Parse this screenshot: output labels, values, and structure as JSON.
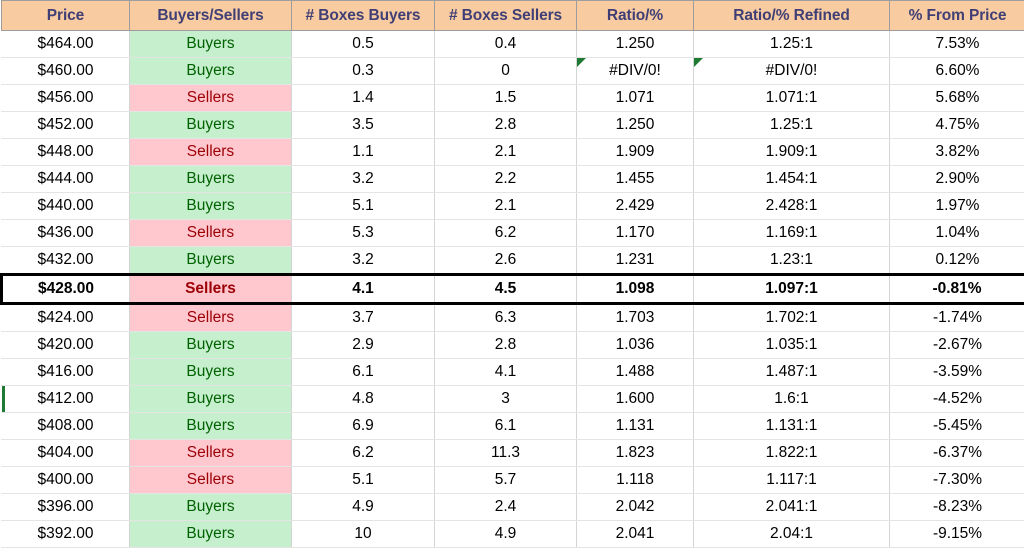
{
  "spreadsheet": {
    "columns": [
      {
        "key": "price",
        "label": "Price"
      },
      {
        "key": "buyers_sellers",
        "label": "Buyers/Sellers"
      },
      {
        "key": "boxes_buyers",
        "label": "# Boxes Buyers"
      },
      {
        "key": "boxes_sellers",
        "label": "# Boxes Sellers"
      },
      {
        "key": "ratio_pct",
        "label": "Ratio/%"
      },
      {
        "key": "ratio_refined",
        "label": "Ratio/% Refined"
      },
      {
        "key": "pct_from_price",
        "label": "% From Price"
      }
    ],
    "colors": {
      "header_fill": "#F8CBA0",
      "header_text": "#3F3F76",
      "good_fill": "#C6EFCE",
      "good_text": "#006100",
      "bad_fill": "#FFC7CE",
      "bad_text": "#9C0006",
      "error_indicator": "#1E7A32",
      "highlight_border": "#000000"
    },
    "rows": [
      {
        "price": "$464.00",
        "buyers_sellers": "Buyers",
        "side": "good",
        "boxes_buyers": "0.5",
        "boxes_sellers": "0.4",
        "ratio_pct": "1.250",
        "ratio_refined": "1.25:1",
        "pct_from_price": "7.53%",
        "highlight": false,
        "error_flags": []
      },
      {
        "price": "$460.00",
        "buyers_sellers": "Buyers",
        "side": "good",
        "boxes_buyers": "0.3",
        "boxes_sellers": "0",
        "ratio_pct": "#DIV/0!",
        "ratio_refined": "#DIV/0!",
        "pct_from_price": "6.60%",
        "highlight": false,
        "error_flags": [
          "ratio_pct",
          "ratio_refined"
        ]
      },
      {
        "price": "$456.00",
        "buyers_sellers": "Sellers",
        "side": "bad",
        "boxes_buyers": "1.4",
        "boxes_sellers": "1.5",
        "ratio_pct": "1.071",
        "ratio_refined": "1.071:1",
        "pct_from_price": "5.68%",
        "highlight": false,
        "error_flags": []
      },
      {
        "price": "$452.00",
        "buyers_sellers": "Buyers",
        "side": "good",
        "boxes_buyers": "3.5",
        "boxes_sellers": "2.8",
        "ratio_pct": "1.250",
        "ratio_refined": "1.25:1",
        "pct_from_price": "4.75%",
        "highlight": false,
        "error_flags": []
      },
      {
        "price": "$448.00",
        "buyers_sellers": "Sellers",
        "side": "bad",
        "boxes_buyers": "1.1",
        "boxes_sellers": "2.1",
        "ratio_pct": "1.909",
        "ratio_refined": "1.909:1",
        "pct_from_price": "3.82%",
        "highlight": false,
        "error_flags": []
      },
      {
        "price": "$444.00",
        "buyers_sellers": "Buyers",
        "side": "good",
        "boxes_buyers": "3.2",
        "boxes_sellers": "2.2",
        "ratio_pct": "1.455",
        "ratio_refined": "1.454:1",
        "pct_from_price": "2.90%",
        "highlight": false,
        "error_flags": []
      },
      {
        "price": "$440.00",
        "buyers_sellers": "Buyers",
        "side": "good",
        "boxes_buyers": "5.1",
        "boxes_sellers": "2.1",
        "ratio_pct": "2.429",
        "ratio_refined": "2.428:1",
        "pct_from_price": "1.97%",
        "highlight": false,
        "error_flags": []
      },
      {
        "price": "$436.00",
        "buyers_sellers": "Sellers",
        "side": "bad",
        "boxes_buyers": "5.3",
        "boxes_sellers": "6.2",
        "ratio_pct": "1.170",
        "ratio_refined": "1.169:1",
        "pct_from_price": "1.04%",
        "highlight": false,
        "error_flags": []
      },
      {
        "price": "$432.00",
        "buyers_sellers": "Buyers",
        "side": "good",
        "boxes_buyers": "3.2",
        "boxes_sellers": "2.6",
        "ratio_pct": "1.231",
        "ratio_refined": "1.23:1",
        "pct_from_price": "0.12%",
        "highlight": false,
        "error_flags": []
      },
      {
        "price": "$428.00",
        "buyers_sellers": "Sellers",
        "side": "bad",
        "boxes_buyers": "4.1",
        "boxes_sellers": "4.5",
        "ratio_pct": "1.098",
        "ratio_refined": "1.097:1",
        "pct_from_price": "-0.81%",
        "highlight": true,
        "error_flags": []
      },
      {
        "price": "$424.00",
        "buyers_sellers": "Sellers",
        "side": "bad",
        "boxes_buyers": "3.7",
        "boxes_sellers": "6.3",
        "ratio_pct": "1.703",
        "ratio_refined": "1.702:1",
        "pct_from_price": "-1.74%",
        "highlight": false,
        "error_flags": []
      },
      {
        "price": "$420.00",
        "buyers_sellers": "Buyers",
        "side": "good",
        "boxes_buyers": "2.9",
        "boxes_sellers": "2.8",
        "ratio_pct": "1.036",
        "ratio_refined": "1.035:1",
        "pct_from_price": "-2.67%",
        "highlight": false,
        "error_flags": []
      },
      {
        "price": "$416.00",
        "buyers_sellers": "Buyers",
        "side": "good",
        "boxes_buyers": "6.1",
        "boxes_sellers": "4.1",
        "ratio_pct": "1.488",
        "ratio_refined": "1.487:1",
        "pct_from_price": "-3.59%",
        "highlight": false,
        "error_flags": []
      },
      {
        "price": "$412.00",
        "buyers_sellers": "Buyers",
        "side": "good",
        "boxes_buyers": "4.8",
        "boxes_sellers": "3",
        "ratio_pct": "1.600",
        "ratio_refined": "1.6:1",
        "pct_from_price": "-4.52%",
        "highlight": false,
        "error_flags": [],
        "edge_sliver": true
      },
      {
        "price": "$408.00",
        "buyers_sellers": "Buyers",
        "side": "good",
        "boxes_buyers": "6.9",
        "boxes_sellers": "6.1",
        "ratio_pct": "1.131",
        "ratio_refined": "1.131:1",
        "pct_from_price": "-5.45%",
        "highlight": false,
        "error_flags": []
      },
      {
        "price": "$404.00",
        "buyers_sellers": "Sellers",
        "side": "bad",
        "boxes_buyers": "6.2",
        "boxes_sellers": "11.3",
        "ratio_pct": "1.823",
        "ratio_refined": "1.822:1",
        "pct_from_price": "-6.37%",
        "highlight": false,
        "error_flags": []
      },
      {
        "price": "$400.00",
        "buyers_sellers": "Sellers",
        "side": "bad",
        "boxes_buyers": "5.1",
        "boxes_sellers": "5.7",
        "ratio_pct": "1.118",
        "ratio_refined": "1.117:1",
        "pct_from_price": "-7.30%",
        "highlight": false,
        "error_flags": []
      },
      {
        "price": "$396.00",
        "buyers_sellers": "Buyers",
        "side": "good",
        "boxes_buyers": "4.9",
        "boxes_sellers": "2.4",
        "ratio_pct": "2.042",
        "ratio_refined": "2.041:1",
        "pct_from_price": "-8.23%",
        "highlight": false,
        "error_flags": []
      },
      {
        "price": "$392.00",
        "buyers_sellers": "Buyers",
        "side": "good",
        "boxes_buyers": "10",
        "boxes_sellers": "4.9",
        "ratio_pct": "2.041",
        "ratio_refined": "2.04:1",
        "pct_from_price": "-9.15%",
        "highlight": false,
        "error_flags": []
      }
    ]
  }
}
